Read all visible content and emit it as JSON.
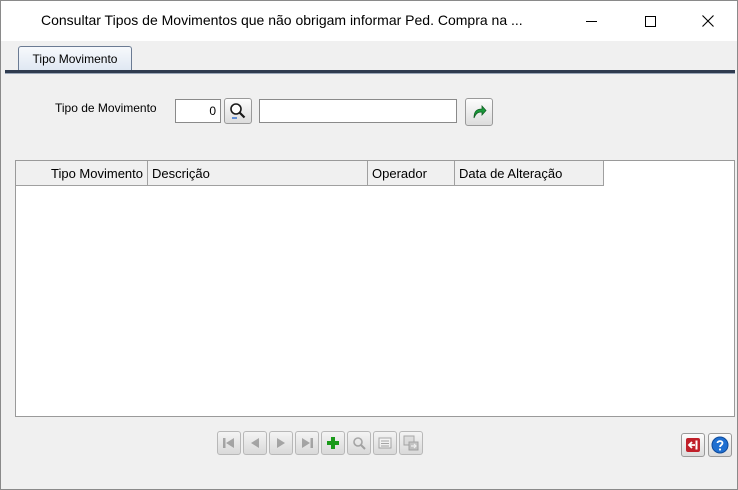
{
  "window": {
    "title": "Consultar Tipos de Movimentos que não obrigam informar Ped. Compra na ..."
  },
  "tabs": [
    {
      "label": "Tipo Movimento",
      "active": true
    }
  ],
  "filter": {
    "label": "Tipo de Movimento",
    "code_value": "0",
    "description_value": ""
  },
  "grid": {
    "columns": [
      "Tipo Movimento",
      "Descrição",
      "Operador",
      "Data de Alteração"
    ],
    "rows": []
  },
  "navigator": {
    "buttons": [
      "first-icon",
      "prior-icon",
      "next-icon",
      "last-icon",
      "plus-icon",
      "search-icon",
      "list-icon",
      "export-icon"
    ]
  },
  "colors": {
    "add": "#1a9a1a",
    "exit": "#c0202a",
    "help": "#1f6fd1"
  }
}
